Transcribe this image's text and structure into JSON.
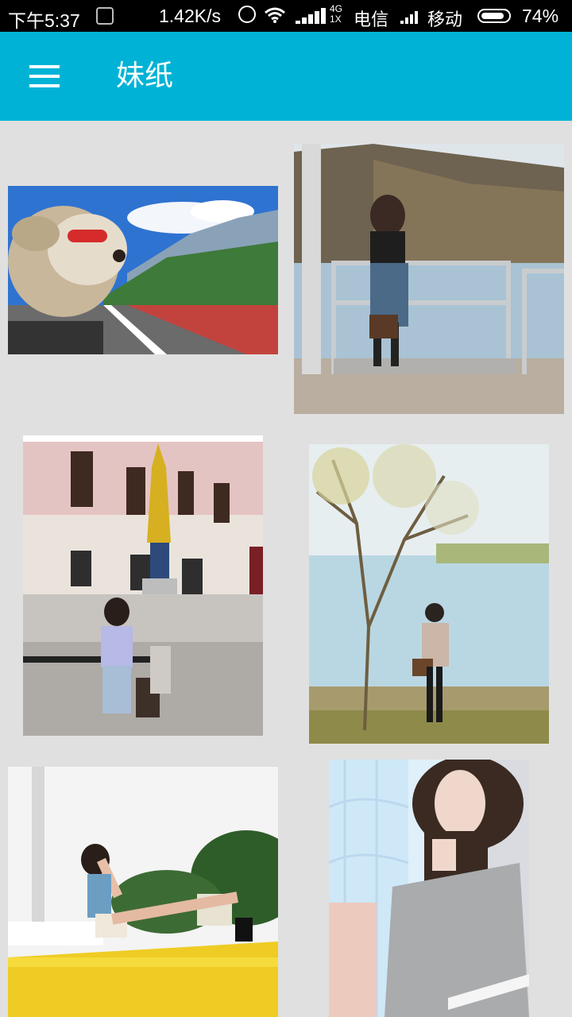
{
  "status_bar": {
    "time": "下午5:37",
    "speed": "1.42K/s",
    "net_top": "4G",
    "net_bottom": "1X",
    "carrier1": "电信",
    "carrier2": "移动",
    "battery": "74%",
    "battery_level": 0.74
  },
  "app_bar": {
    "menu_icon": "menu-icon",
    "title": "妹纸",
    "color": "#00b3d6"
  },
  "gallery": {
    "photos": [
      {
        "subject": "dog-with-goggles"
      },
      {
        "subject": "woman-by-lake-railing"
      },
      {
        "subject": "woman-by-fountain-statue"
      },
      {
        "subject": "woman-under-tree-by-lake"
      },
      {
        "subject": "woman-on-yellow-boat"
      },
      {
        "subject": "woman-by-window-portrait"
      }
    ]
  }
}
